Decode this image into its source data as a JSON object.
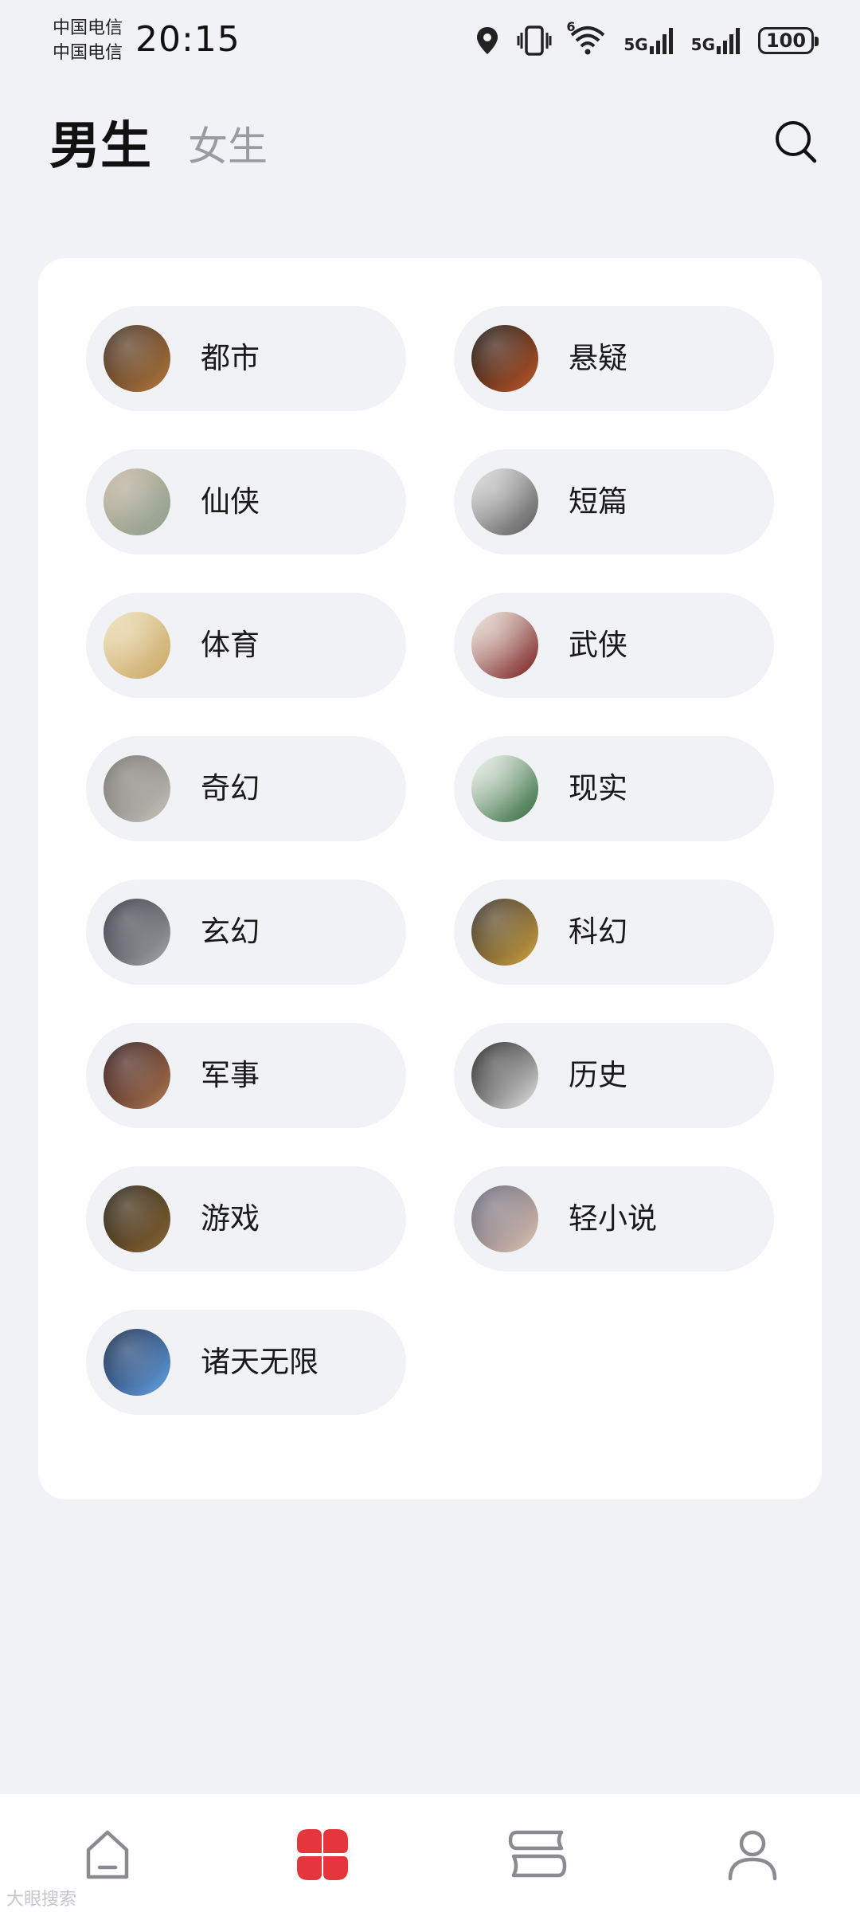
{
  "status_bar": {
    "carrier_1": "中国电信",
    "carrier_2": "中国电信",
    "time": "20:15",
    "net_1": "5G",
    "net_2": "5G",
    "wifi_badge": "6",
    "battery": "100"
  },
  "header": {
    "tab_male": "男生",
    "tab_female": "女生",
    "active_tab": "男生"
  },
  "categories": [
    {
      "label": "都市",
      "color1": "#3a2a1e",
      "color2": "#b5793e"
    },
    {
      "label": "悬疑",
      "color1": "#111111",
      "color2": "#c25a2c"
    },
    {
      "label": "仙侠",
      "color1": "#c9b6a4",
      "color2": "#8da18e"
    },
    {
      "label": "短篇",
      "color1": "#e2e2e2",
      "color2": "#5a5a5a"
    },
    {
      "label": "体育",
      "color1": "#efe2bb",
      "color2": "#c9a764"
    },
    {
      "label": "武侠",
      "color1": "#f1ece2",
      "color2": "#7a1f1f"
    },
    {
      "label": "奇幻",
      "color1": "#6c6a64",
      "color2": "#c9c6bf"
    },
    {
      "label": "现实",
      "color1": "#f4f6f1",
      "color2": "#2f6a3a"
    },
    {
      "label": "玄幻",
      "color1": "#2a2d36",
      "color2": "#a8a9ad"
    },
    {
      "label": "科幻",
      "color1": "#2f2a24",
      "color2": "#d2a443"
    },
    {
      "label": "军事",
      "color1": "#2a1114",
      "color2": "#b37b55"
    },
    {
      "label": "历史",
      "color1": "#141414",
      "color2": "#e8e8e8"
    },
    {
      "label": "游戏",
      "color1": "#241c12",
      "color2": "#8b6a36"
    },
    {
      "label": "轻小说",
      "color1": "#5c5f73",
      "color2": "#e1c4b2"
    },
    {
      "label": "诸天无限",
      "color1": "#0e2244",
      "color2": "#6aa6e6"
    }
  ],
  "bottom_nav": [
    {
      "name": "home",
      "icon": "home-icon",
      "active": false
    },
    {
      "name": "categories",
      "icon": "clover-icon",
      "active": true
    },
    {
      "name": "bookshelf",
      "icon": "bookshelf-icon",
      "active": false
    },
    {
      "name": "profile",
      "icon": "person-icon",
      "active": false
    }
  ],
  "colors": {
    "accent": "#e5363e",
    "background": "#f1f2f5",
    "pill": "#f1f2f5",
    "icon_inactive": "#8a8b90"
  },
  "watermark": "大眼搜索"
}
